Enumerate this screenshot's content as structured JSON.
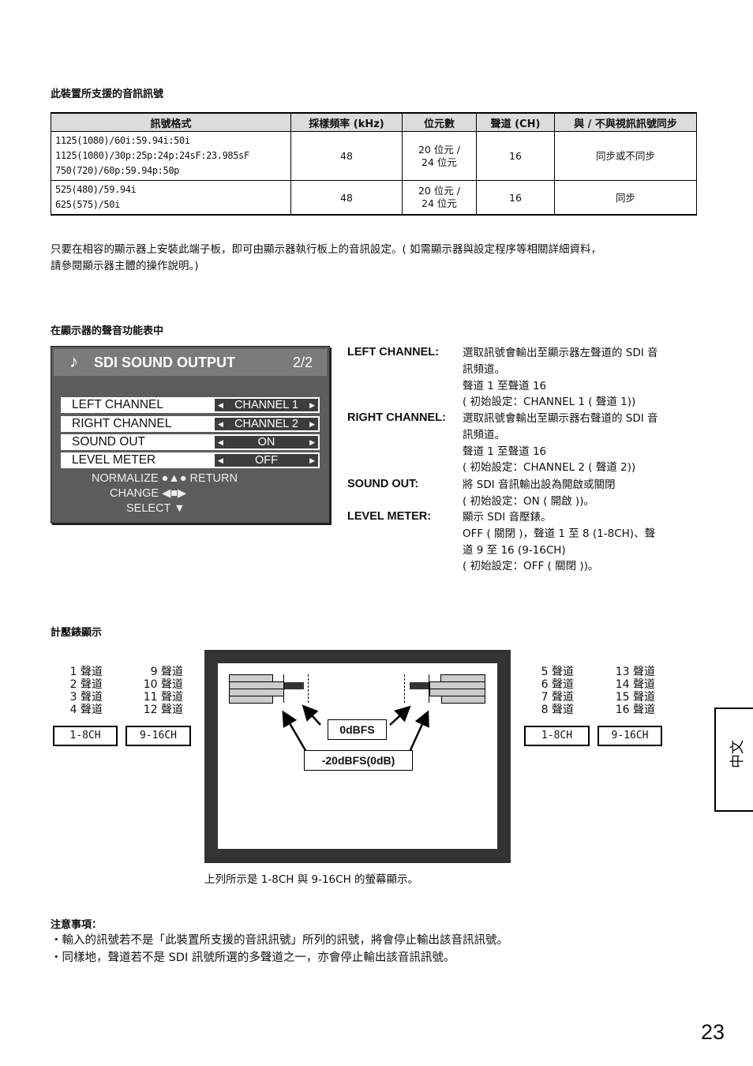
{
  "section1": {
    "heading": "此裝置所支援的音訊訊號",
    "table": {
      "headers": [
        "訊號格式",
        "採樣頻率 (kHz)",
        "位元數",
        "聲道 (CH)",
        "與 / 不與視訊訊號同步"
      ],
      "rows": [
        {
          "format_lines": [
            "1125(1080)/60i:59.94i:50i",
            "1125(1080)/30p:25p:24p:24sF:23.985sF",
            "750(720)/60p:59.94p:50p"
          ],
          "sampling": "48",
          "bits_line1": "20 位元 /",
          "bits_line2": "24 位元",
          "channels": "16",
          "sync": "同步或不同步"
        },
        {
          "format_lines": [
            "525(480)/59.94i",
            "625(575)/50i"
          ],
          "sampling": "48",
          "bits_line1": "20 位元 /",
          "bits_line2": "24 位元",
          "channels": "16",
          "sync": "同步"
        }
      ]
    },
    "paragraph_line1": "只要在相容的顯示器上安裝此端子板，即可由顯示器執行板上的音訊設定。( 如需顯示器與設定程序等相關詳細資料，",
    "paragraph_line2": "請參閱顯示器主體的操作說明。)"
  },
  "section2": {
    "heading": "在顯示器的聲音功能表中",
    "osd": {
      "icon": "music-note-icon",
      "title": "SDI SOUND OUTPUT",
      "page": "2/2",
      "rows": [
        {
          "label": "LEFT CHANNEL",
          "value": "CHANNEL 1"
        },
        {
          "label": "RIGHT CHANNEL",
          "value": "CHANNEL 2"
        },
        {
          "label": "SOUND OUT",
          "value": "ON"
        },
        {
          "label": "LEVEL METER",
          "value": "OFF"
        }
      ],
      "nav_normalize": "NORMALIZE",
      "nav_return": "RETURN",
      "nav_change": "CHANGE",
      "nav_select": "SELECT"
    },
    "descriptions": [
      {
        "label": "LEFT CHANNEL:",
        "lines": [
          "選取訊號會輸出至顯示器左聲道的 SDI 音",
          "訊頻道。",
          "聲道 1 至聲道 16",
          "( 初始設定：CHANNEL 1 ( 聲道 1))"
        ]
      },
      {
        "label": "RIGHT CHANNEL:",
        "lines": [
          "選取訊號會輸出至顯示器右聲道的 SDI 音",
          "訊頻道。",
          "聲道 1 至聲道 16",
          "( 初始設定：CHANNEL 2 ( 聲道 2))"
        ]
      },
      {
        "label": "SOUND OUT:",
        "lines": [
          "將 SDI 音訊輸出設為開啟或關閉",
          "( 初始設定：ON ( 開啟 ))。"
        ]
      },
      {
        "label": "LEVEL METER:",
        "lines": [
          "顯示 SDI 音壓錶。",
          "OFF ( 關閉 )，聲道 1 至 8 (1-8CH)、聲",
          "道 9 至 16 (9-16CH)",
          "( 初始設定：OFF ( 關閉 ))。"
        ]
      }
    ]
  },
  "section3": {
    "heading": "計壓錶顯示",
    "left_18": [
      "1 聲道",
      "2 聲道",
      "3 聲道",
      "4 聲道"
    ],
    "left_916": [
      "9 聲道",
      "10 聲道",
      "11 聲道",
      "12 聲道"
    ],
    "right_18": [
      "5 聲道",
      "6 聲道",
      "7 聲道",
      "8 聲道"
    ],
    "right_916": [
      "13 聲道",
      "14 聲道",
      "15 聲道",
      "16 聲道"
    ],
    "box_18": "1-8CH",
    "box_916": "9-16CH",
    "label_0dbfs": "0dBFS",
    "label_20dbfs": "-20dBFS(0dB)",
    "caption": "上列所示是 1-8CH 與 9-16CH 的螢幕顯示。"
  },
  "notes": {
    "heading": "注意事項：",
    "items": [
      "・輸入的訊號若不是「此裝置所支援的音訊訊號」所列的訊號，將會停止輸出該音訊訊號。",
      "・同樣地，聲道若不是 SDI 訊號所選的多聲道之一，亦會停止輸出該音訊訊號。"
    ]
  },
  "side_tab": "中文",
  "page_number": "23"
}
